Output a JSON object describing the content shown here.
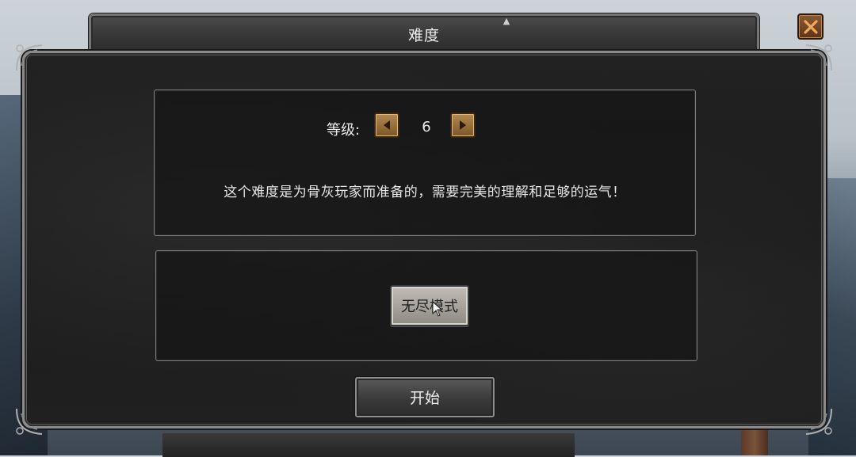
{
  "dialog": {
    "title": "难度",
    "close_icon": "close-x-icon"
  },
  "difficulty": {
    "level_label": "等级:",
    "level_value": "6",
    "decrease_icon": "arrow-left-icon",
    "increase_icon": "arrow-right-icon",
    "description": "这个难度是为骨灰玩家而准备的，需要完美的理解和足够的运气！"
  },
  "mode": {
    "endless_label": "无尽模式"
  },
  "actions": {
    "start_label": "开始"
  },
  "colors": {
    "panel_bg": "#1e1e1e",
    "panel_border": "#8a8a8a",
    "arrow_button": "#a07840",
    "close_button": "#7a4a24",
    "close_x": "#e8a060"
  }
}
